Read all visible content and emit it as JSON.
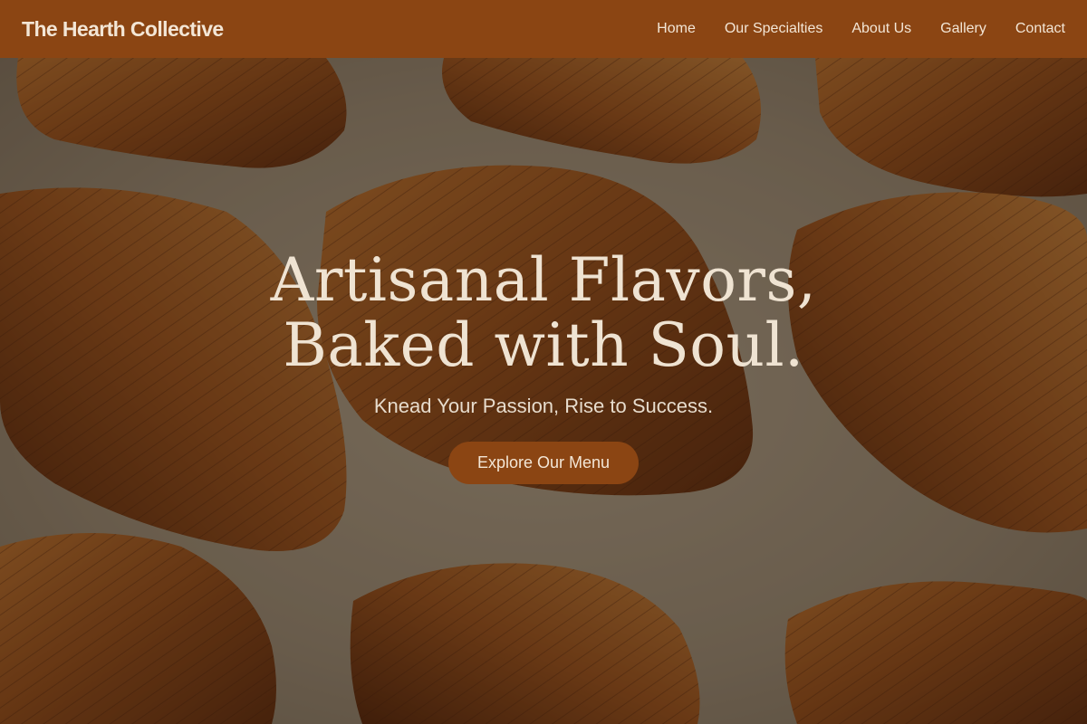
{
  "brand": {
    "name": "The Hearth Collective"
  },
  "nav": {
    "items": [
      {
        "label": "Home"
      },
      {
        "label": "Our Specialties"
      },
      {
        "label": "About Us"
      },
      {
        "label": "Gallery"
      },
      {
        "label": "Contact"
      }
    ]
  },
  "hero": {
    "title_line1": "Artisanal Flavors,",
    "title_line2": "Baked with Soul.",
    "subtitle": "Knead Your Passion, Rise to Success.",
    "cta_label": "Explore Our Menu",
    "image": "croissants-photo"
  },
  "colors": {
    "nav_bg": "#8b4513",
    "button_bg": "#8b4513",
    "text_light": "#f3e6d6"
  }
}
